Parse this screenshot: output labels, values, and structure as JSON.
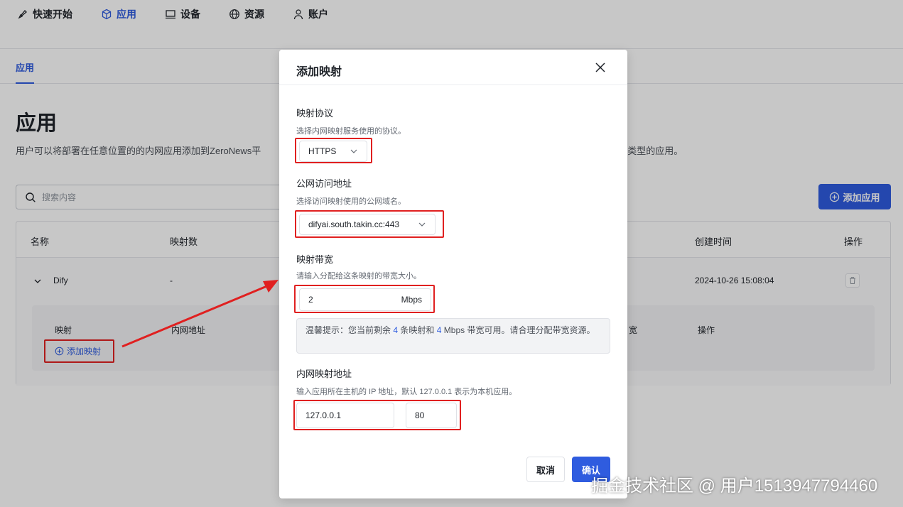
{
  "nav": {
    "items": [
      {
        "label": "快速开始",
        "icon": "rocket-icon"
      },
      {
        "label": "应用",
        "icon": "cube-icon"
      },
      {
        "label": "设备",
        "icon": "monitor-icon"
      },
      {
        "label": "资源",
        "icon": "globe-icon"
      },
      {
        "label": "账户",
        "icon": "user-icon"
      }
    ],
    "active": "应用"
  },
  "subnav": {
    "tab": "应用"
  },
  "page": {
    "title": "应用",
    "description": "用户可以将部署在任意位置的的内网应用添加到ZeroNews平",
    "description_tail": "协议类型的应用。"
  },
  "search": {
    "placeholder": "搜索内容"
  },
  "add_app_button": "添加应用",
  "table": {
    "headers": {
      "name": "名称",
      "mappings": "映射数",
      "created": "创建时间",
      "actions": "操作"
    },
    "row": {
      "name": "Dify",
      "mappings": "-",
      "created": "2024-10-26 15:08:04"
    },
    "inner": {
      "col_mapping": "映射",
      "col_internal": "内网地址",
      "col_bandwidth_tail": "宽",
      "col_actions": "操作",
      "add_mapping": "添加映射"
    }
  },
  "modal": {
    "title": "添加映射",
    "protocol": {
      "label": "映射协议",
      "help": "选择内网映射服务使用的协议。",
      "value": "HTTPS"
    },
    "public_address": {
      "label": "公网访问地址",
      "help": "选择访问映射使用的公网域名。",
      "value": "difyai.south.takin.cc:443"
    },
    "bandwidth": {
      "label": "映射带宽",
      "help": "请输入分配给这条映射的带宽大小。",
      "value": "2",
      "unit": "Mbps"
    },
    "tip": {
      "prefix": "温馨提示：您当前剩余",
      "mappings": "4",
      "mid": "条映射和",
      "bandwidth": "4",
      "suffix": "Mbps 带宽可用。请合理分配带宽资源。"
    },
    "internal": {
      "label": "内网映射地址",
      "help": "输入应用所在主机的 IP 地址，默认 127.0.0.1 表示为本机应用。",
      "host": "127.0.0.1",
      "port": "80"
    },
    "cancel": "取消",
    "confirm": "确认"
  },
  "watermark": "掘金技术社区 @ 用户1513947794460",
  "colors": {
    "primary": "#2f5cdf",
    "annotation": "#e02020"
  }
}
